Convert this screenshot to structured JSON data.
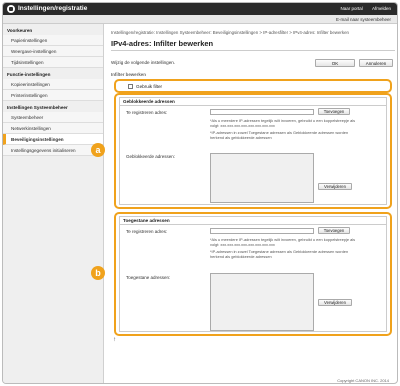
{
  "header": {
    "title": "Instellingen/registratie",
    "links": [
      "Naar portal",
      "Afmelden"
    ],
    "email_link": "E-mail naar systeembeheer"
  },
  "sidebar": {
    "sections": [
      {
        "heading": "Voorkeuren",
        "items": [
          "Papierinstellingen",
          "Weergave-instellingen",
          "Tijdsinstellingen"
        ]
      },
      {
        "heading": "Functie-instellingen",
        "items": [
          "Kopieerinstellingen",
          "Printerinstellingen"
        ]
      },
      {
        "heading": "Instellingen Systeembeheer",
        "items": [
          "Systeembeheer",
          "Netwerkinstellingen",
          "Beveiligingsinstellingen",
          "Instellingsgegevens initialiseren"
        ]
      }
    ],
    "active": "Beveiligingsinstellingen"
  },
  "main": {
    "breadcrumb": "Instellingen/registratie: Instellingen Systeembeheer: Beveiligingsinstellingen > IP-adresfilter > IPv4-adres: Infilter bewerken",
    "title": "IPv4-adres: Infilter bewerken",
    "prompt": "Wijzig de volgende instellingen.",
    "ok_label": "OK",
    "cancel_label": "Annuleren",
    "section_caption": "Infilter bewerken",
    "use_filter_label": "Gebruik filter",
    "blocked": {
      "title": "Geblokkeerde adressen",
      "register_label": "Te registreren adres:",
      "add_label": "Toevoegen",
      "help1": "*Als u meerdere IP-adressen tegelijk wilt invoeren, gebruikt u een koppelstreepje als volgt: xxx.xxx.xxx.xxx-xxx.xxx.xxx.xxx",
      "help2": "*IP-adressen in zowel Toegestane adressen als Geblokkeerde adressen worden herkend als geblokkeerde adressen",
      "list_label": "Geblokkeerde adressen:",
      "remove_label": "Verwijderen"
    },
    "allowed": {
      "title": "Toegestane adressen",
      "register_label": "Te registreren adres:",
      "add_label": "Toevoegen",
      "help1": "*Als u meerdere IP-adressen tegelijk wilt invoeren, gebruikt u een koppelstreepje als volgt: xxx.xxx.xxx.xxx-xxx.xxx.xxx.xxx",
      "help2": "*IP-adressen in zowel Toegestane adressen als Geblokkeerde adressen worden herkend als geblokkeerde adressen",
      "list_label": "Toegestane adressen:",
      "remove_label": "Verwijderen"
    },
    "to_top": "↑",
    "footer": "Copyright CANON INC. 2014"
  },
  "callouts": [
    "a",
    "b"
  ],
  "colors": {
    "accent": "#f0a21c",
    "topbar": "#2a2a2a"
  }
}
